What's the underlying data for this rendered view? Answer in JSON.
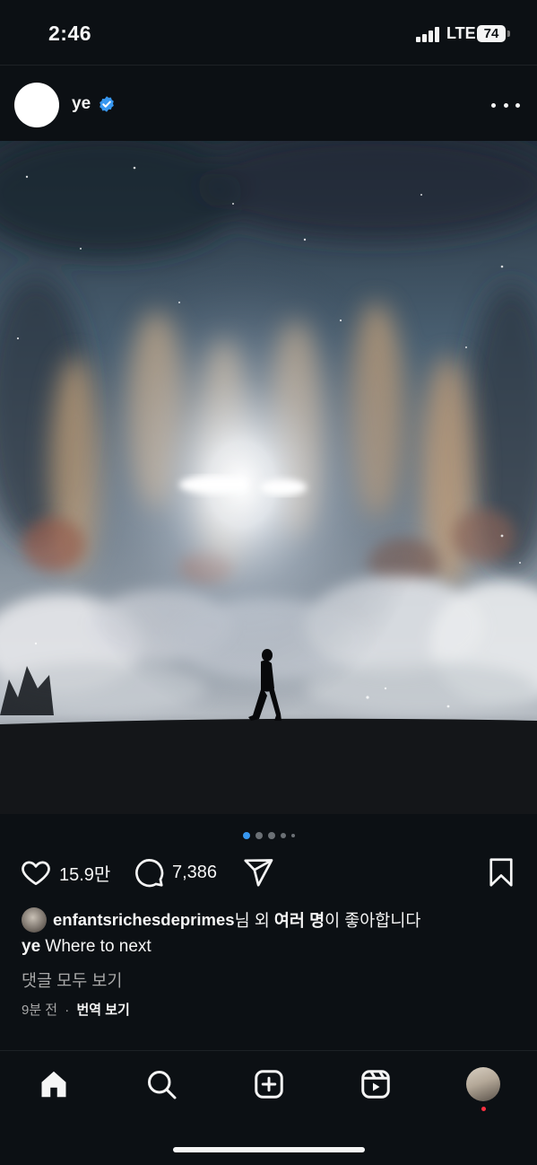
{
  "status_bar": {
    "time": "2:46",
    "network": "LTE",
    "battery": "74"
  },
  "post": {
    "author": "ye",
    "verified": true,
    "image_description_icon": "photo",
    "carousel": {
      "count": 5,
      "active_index": 0
    },
    "likes_count": "15.9만",
    "comments_count": "7,386",
    "liked_by": "enfantsrichesdeprimes",
    "liked_by_suffix": "님 외 ",
    "liked_by_others": "여러 명",
    "liked_by_end": "이 좋아합니다",
    "caption_user": "ye",
    "caption_text": "Where to next",
    "view_comments": "댓글 모두 보기",
    "time_ago": "9분 전",
    "separator": "·",
    "translate": "번역 보기"
  },
  "icons": {
    "like": "heart-icon",
    "comment": "comment-icon",
    "share": "send-icon",
    "save": "bookmark-icon",
    "home": "home-icon",
    "search": "search-icon",
    "create": "plus-square-icon",
    "reels": "reels-icon"
  },
  "colors": {
    "background": "#0c1014",
    "verified": "#3797f0",
    "active_dot": "#3797f0",
    "notification": "#ff3040"
  }
}
